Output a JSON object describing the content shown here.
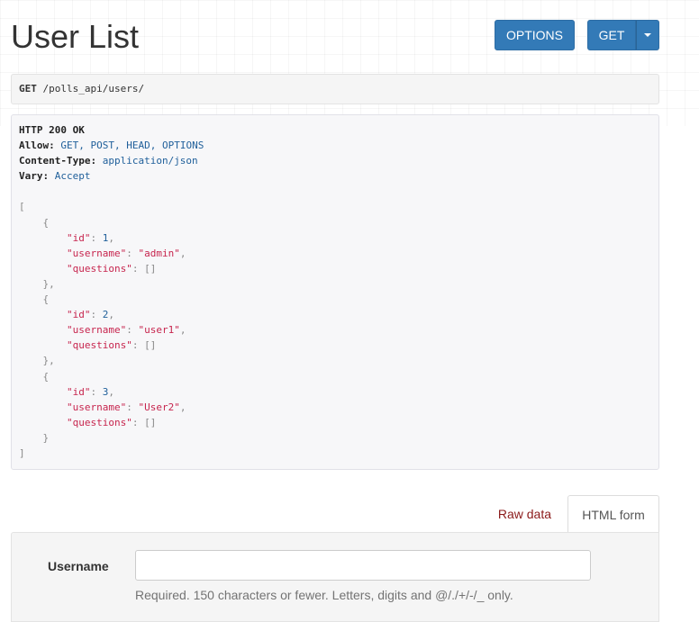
{
  "page": {
    "title": "User List"
  },
  "toolbar": {
    "options_label": "OPTIONS",
    "get_label": "GET"
  },
  "request": {
    "method": "GET",
    "path": "/polls_api/users/"
  },
  "response": {
    "status": "HTTP 200 OK",
    "headers": [
      {
        "key": "Allow:",
        "value": "GET, POST, HEAD, OPTIONS"
      },
      {
        "key": "Content-Type:",
        "value": "application/json"
      },
      {
        "key": "Vary:",
        "value": "Accept"
      }
    ],
    "body": [
      {
        "id": "1",
        "username": "\"admin\"",
        "questions": "[]"
      },
      {
        "id": "2",
        "username": "\"user1\"",
        "questions": "[]"
      },
      {
        "id": "3",
        "username": "\"User2\"",
        "questions": "[]"
      }
    ],
    "tokens": {
      "open_bracket": "[",
      "close_bracket": "]",
      "open_brace": "{",
      "close_brace_comma": "},",
      "close_brace": "}",
      "key_id": "\"id\"",
      "key_username": "\"username\"",
      "key_questions": "\"questions\"",
      "colon": ": ",
      "comma": ","
    }
  },
  "tabs": {
    "raw_data": "Raw data",
    "html_form": "HTML form"
  },
  "form": {
    "username_label": "Username",
    "username_value": "",
    "username_help": "Required. 150 characters or fewer. Letters, digits and @/./+/-/_ only."
  },
  "colors": {
    "primary": "#337ab7",
    "json_key": "#c7254e",
    "json_number": "#1f5f9a",
    "tab_link": "#8b1a1a"
  }
}
